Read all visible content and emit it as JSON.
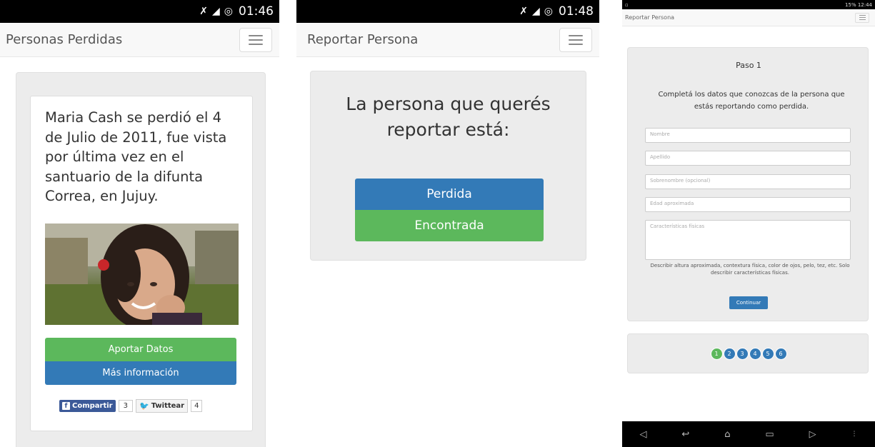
{
  "screen1": {
    "status": {
      "time": "01:46"
    },
    "navbar": {
      "title": "Personas Perdidas"
    },
    "story": "Maria Cash se perdió el 4 de Julio de 2011, fue vista por última vez en el santuario de la difunta Correa, en Jujuy.",
    "buttons": {
      "aportar": "Aportar Datos",
      "mas_info": "Más información"
    },
    "social": {
      "share_label": "Compartir",
      "share_count": "3",
      "tweet_label": "Twittear",
      "tweet_count": "4"
    }
  },
  "screen2": {
    "status": {
      "time": "01:48"
    },
    "navbar": {
      "title": "Reportar Persona"
    },
    "question": "La persona que querés reportar está:",
    "buttons": {
      "perdida": "Perdida",
      "encontrada": "Encontrada"
    }
  },
  "screen3": {
    "status": {
      "info": "15% 12:44"
    },
    "navbar": {
      "title": "Reportar Persona"
    },
    "step_title": "Paso 1",
    "intro": "Completá los datos que conozcas de la persona que estás reportando como perdida.",
    "fields": {
      "nombre": "Nombre",
      "apellido": "Apellido",
      "sobrenombre": "Sobrenombre (opcional)",
      "edad": "Edad aproximada",
      "caracteristicas": "Características físicas"
    },
    "help": "Describir altura aproximada, contextura física, color de ojos, pelo, tez, etc. Solo describir características físicas.",
    "continue": "Continuar",
    "steps": [
      "1",
      "2",
      "3",
      "4",
      "5",
      "6"
    ],
    "colors": {
      "active_step": "#5cb85c",
      "step": "#337ab7"
    }
  }
}
